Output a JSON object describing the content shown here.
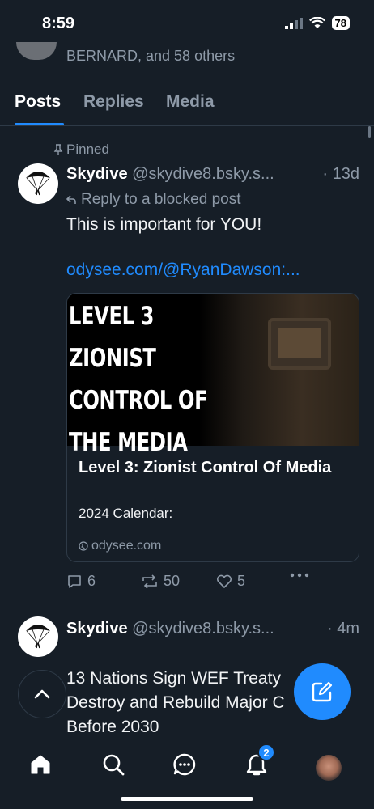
{
  "status_bar": {
    "time": "8:59",
    "battery": "78"
  },
  "followers": {
    "text": "BERNARD, and 58 others"
  },
  "tabs": [
    {
      "label": "Posts",
      "active": true
    },
    {
      "label": "Replies",
      "active": false
    },
    {
      "label": "Media",
      "active": false
    }
  ],
  "posts": [
    {
      "pinned_label": "Pinned",
      "display_name": "Skydive",
      "handle": "@skydive8.bsky.s...",
      "time": "· 13d",
      "reply_note": "Reply to a blocked post",
      "text": "This is important for YOU!",
      "link": "odysee.com/@RyanDawson:...",
      "embed": {
        "image_lines": [
          "LEVEL 3",
          "ZIONIST",
          "CONTROL OF",
          "THE MEDIA"
        ],
        "title": "Level 3: Zionist Control Of Media",
        "description": "2024 Calendar:",
        "domain": "odysee.com"
      },
      "replies": "6",
      "reposts": "50",
      "likes": "5"
    },
    {
      "display_name": "Skydive",
      "handle": "@skydive8.bsky.s...",
      "time": "· 4m",
      "text_lines": [
        "13 Nations Sign WEF Treaty",
        "Destroy and Rebuild Major C",
        "Before 2030"
      ]
    }
  ],
  "nav": {
    "items": [
      "home-icon",
      "search-icon",
      "chat-icon",
      "bell-icon",
      "profile-avatar"
    ],
    "notification_count": "2"
  },
  "colors": {
    "background": "#161e27",
    "accent": "#208bfe",
    "muted": "#8e9aa8"
  }
}
